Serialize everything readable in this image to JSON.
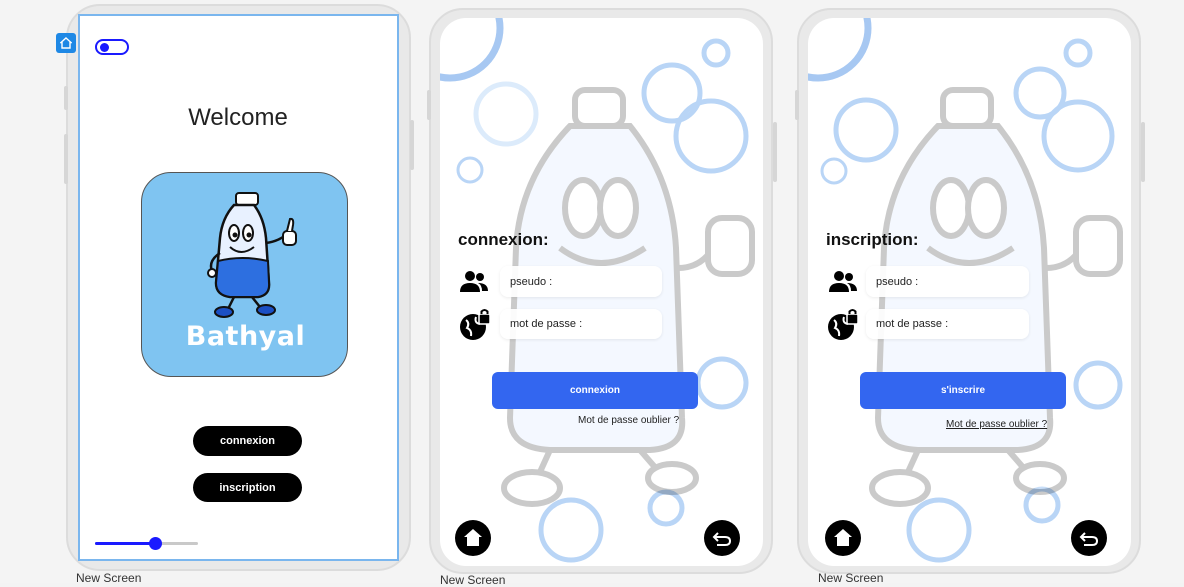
{
  "canvas": {
    "screen_label": "New Screen"
  },
  "screen1": {
    "title": "Welcome",
    "logo": {
      "brand": "Bathyal",
      "background": "#7fc4f1"
    },
    "buttons": {
      "connexion": "connexion",
      "inscription": "inscription"
    },
    "toggle": {
      "on": true,
      "accent": "#1a1aff"
    },
    "slider": {
      "value_fraction": 0.58
    },
    "selection_badge_icon": "home-icon"
  },
  "screen2": {
    "title": "connexion:",
    "fields": {
      "pseudo_placeholder": "pseudo :",
      "password_placeholder": "mot de passe :"
    },
    "submit_label": "connexion",
    "forgot_label": "Mot de passe oublier ?",
    "accent": "#3366f0",
    "nav": {
      "home_icon": "home-icon",
      "back_icon": "undo-icon"
    }
  },
  "screen3": {
    "title": "inscription:",
    "fields": {
      "pseudo_placeholder": "pseudo :",
      "password_placeholder": "mot de passe :"
    },
    "submit_label": "s'inscrire",
    "forgot_label": "Mot de passe oublier ?",
    "accent": "#3366f0",
    "nav": {
      "home_icon": "home-icon",
      "back_icon": "undo-icon"
    }
  }
}
